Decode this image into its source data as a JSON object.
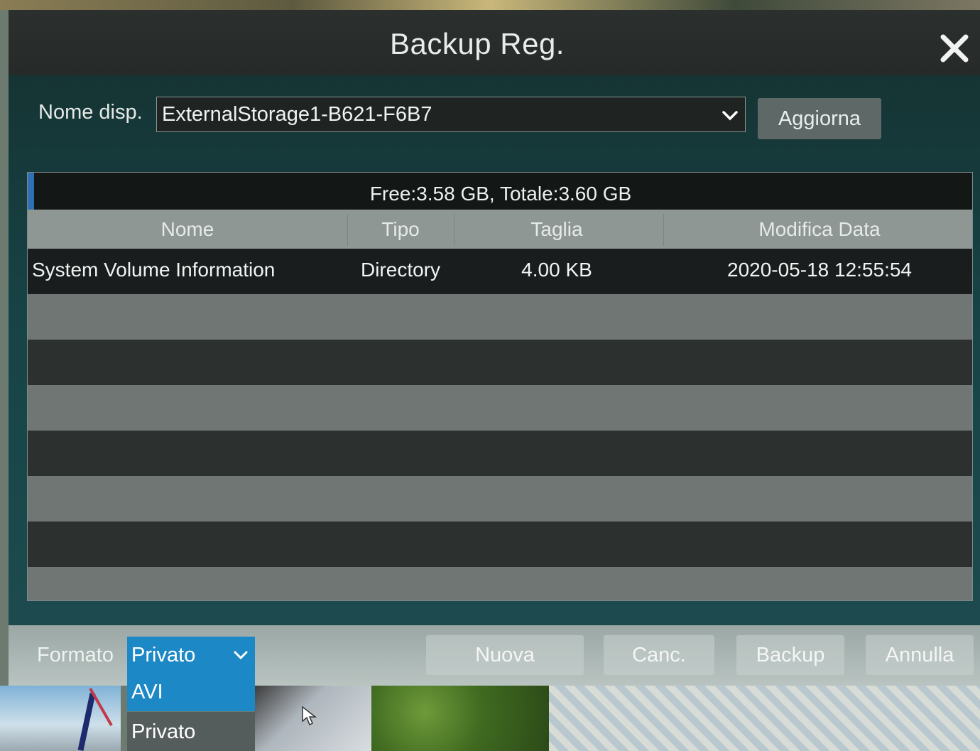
{
  "dialog": {
    "title": "Backup Reg.",
    "close_icon": "close-icon"
  },
  "device": {
    "label": "Nome disp.",
    "value": "ExternalStorage1-B621-F6B7",
    "refresh_label": "Aggiorna"
  },
  "table": {
    "storage_info": "Free:3.58 GB, Totale:3.60 GB",
    "columns": [
      "Nome",
      "Tipo",
      "Taglia",
      "Modifica Data"
    ],
    "rows": [
      {
        "name": "System Volume Information",
        "type": "Directory",
        "size": "4.00 KB",
        "modified": "2020-05-18 12:55:54"
      }
    ]
  },
  "footer": {
    "format_label": "Formato",
    "format_value": "Privato",
    "format_options": [
      "AVI",
      "Privato"
    ],
    "buttons": {
      "new": "Nuova",
      "delete": "Canc.",
      "backup": "Backup",
      "cancel": "Annulla"
    }
  },
  "colors": {
    "accent": "#1d88c6",
    "dialog_bg": "#174346",
    "titlebar_bg": "#2b2f2d"
  }
}
